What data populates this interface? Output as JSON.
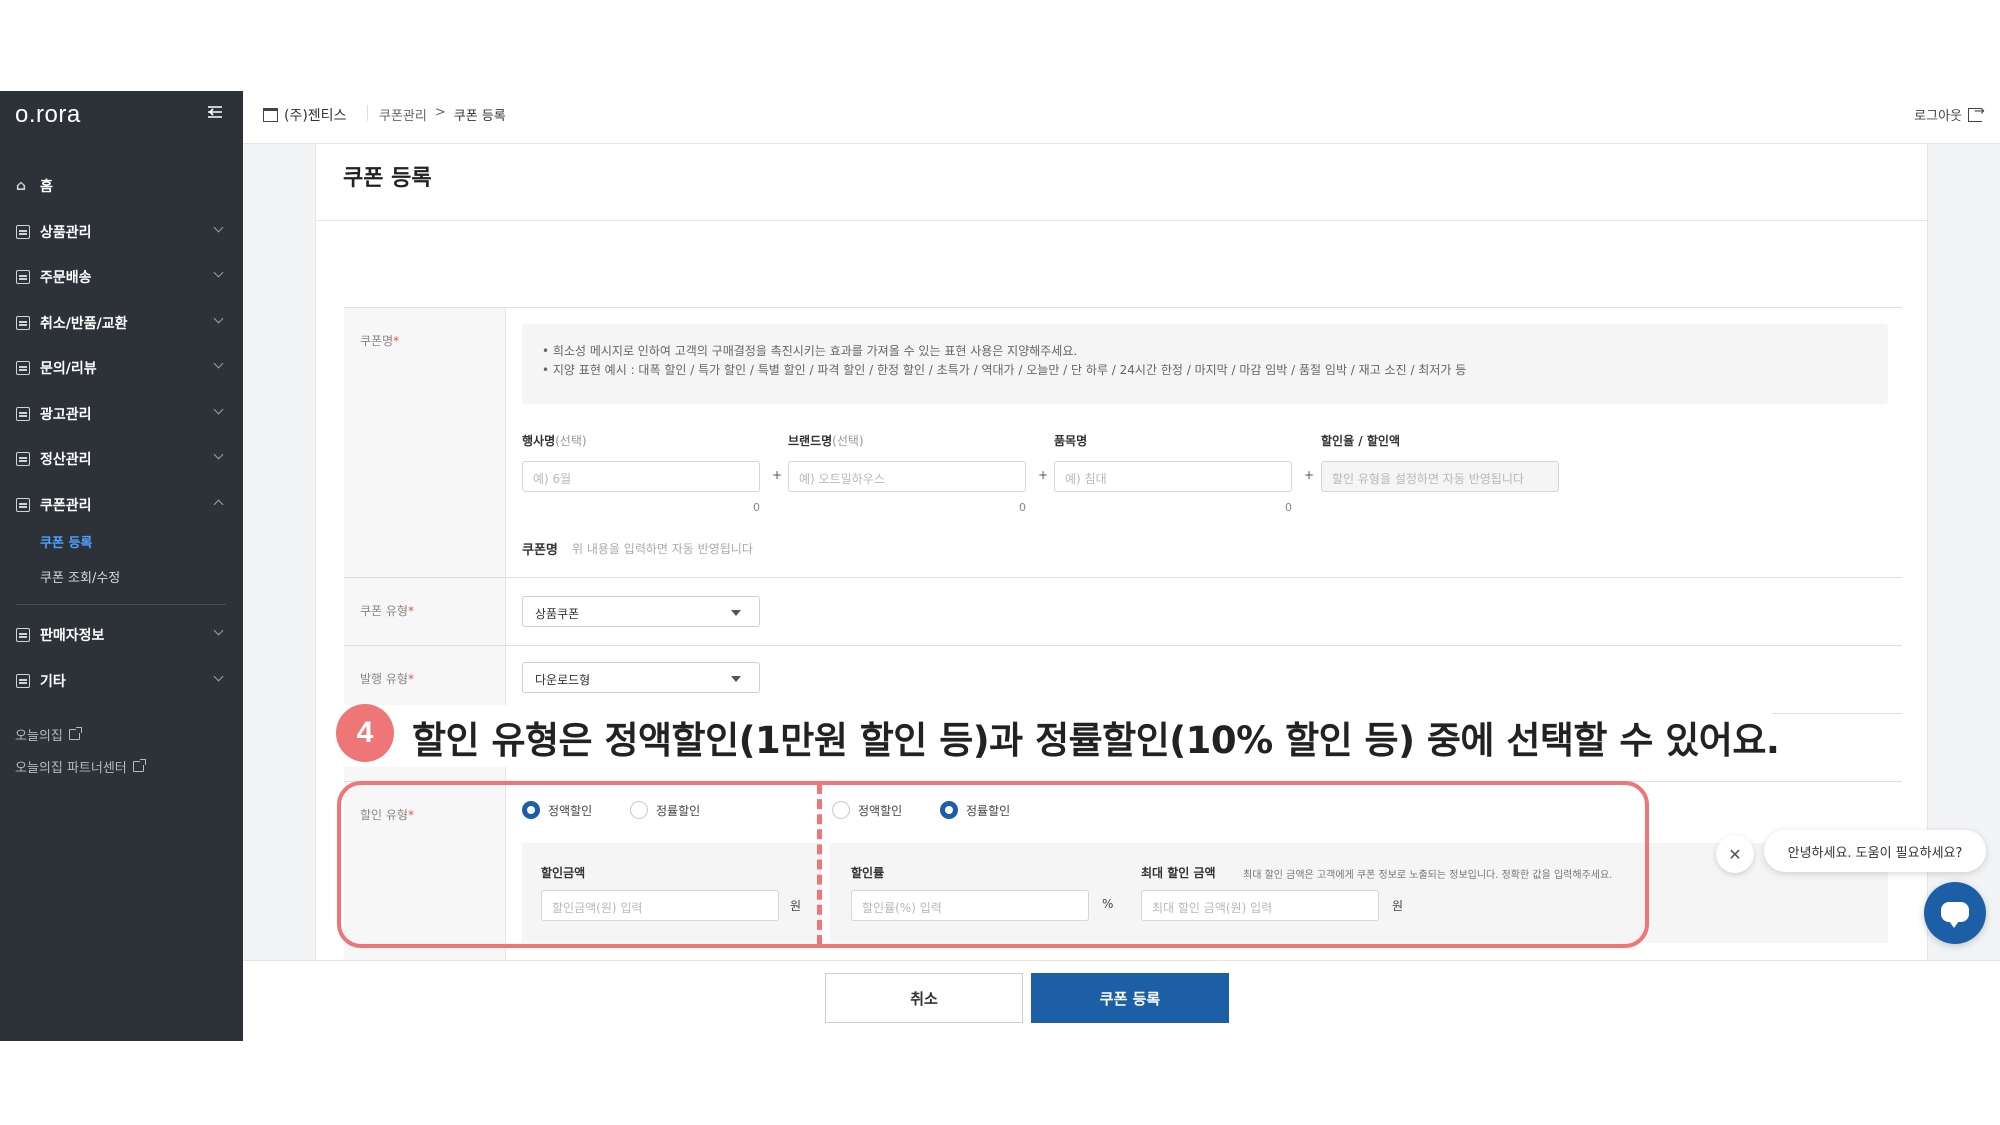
{
  "sidebar": {
    "logo": "o.rora",
    "home": "홈",
    "items": [
      {
        "label": "상품관리"
      },
      {
        "label": "주문배송"
      },
      {
        "label": "취소/반품/교환"
      },
      {
        "label": "문의/리뷰"
      },
      {
        "label": "광고관리"
      },
      {
        "label": "정산관리"
      },
      {
        "label": "쿠폰관리"
      }
    ],
    "coupon_sub": [
      "쿠폰 등록",
      "쿠폰 조회/수정"
    ],
    "items2": [
      {
        "label": "판매자정보"
      },
      {
        "label": "기타"
      }
    ],
    "links": [
      "오늘의집",
      "오늘의집 파트너센터"
    ]
  },
  "topbar": {
    "store": "(주)젠티스",
    "breadcrumb": [
      "쿠폰관리",
      ">",
      "쿠폰 등록"
    ],
    "logout": "로그아웃"
  },
  "page": {
    "title": "쿠폰 등록"
  },
  "form": {
    "coupon_name_label": "쿠폰명",
    "req": "*",
    "notice": [
      "• 희소성 메시지로 인하여 고객의 구매결정을 촉진시키는 효과를 가져올 수 있는 표현 사용은 지양해주세요.",
      "• 지양 표현 예시 : 대폭 할인 / 특가 할인 / 특별 할인 / 파격 할인 / 한정 할인 / 초특가 / 역대가 / 오늘만 / 단 하루 / 24시간 한정 / 마지막 / 마감 임박 / 품절 임박 / 재고 소진 / 최저가 등"
    ],
    "event_label": "행사명",
    "brand_label": "브랜드명",
    "optional": "(선택)",
    "item_label": "품목명",
    "discount_label": "할인율 / 할인액",
    "event_placeholder": "예) 6월",
    "brand_placeholder": "예) 오트밀하우스",
    "item_placeholder": "예) 침대",
    "discount_placeholder": "할인 유형을 설정하면 자동 반영됩니다",
    "plus": "+",
    "counts": [
      "0",
      "0",
      "0"
    ],
    "cname_label": "쿠폰명",
    "cname_hint": "위 내용을 입력하면 자동 반영됩니다",
    "coupon_type_label": "쿠폰 유형",
    "coupon_type_value": "상품쿠폰",
    "issue_type_label": "발행 유형",
    "issue_type_value": "다운로드형",
    "discount_type_label": "할인 유형",
    "radio_fixed": "정액할인",
    "radio_rate": "정률할인",
    "amount_label": "할인금액",
    "amount_placeholder": "할인금액(원) 입력",
    "won": "원",
    "rate_label": "할인률",
    "rate_placeholder": "할인률(%) 입력",
    "percent": "%",
    "max_label": "최대 할인 금액",
    "max_hint": "최대 할인 금액은 고객에게 쿠폰 정보로 노출되는 정보입니다. 정확한 값을 입력해주세요.",
    "max_placeholder": "최대 할인 금액(원) 입력"
  },
  "footer": {
    "cancel": "취소",
    "submit": "쿠폰 등록"
  },
  "chat": {
    "greeting": "안녕하세요. 도움이 필요하세요?",
    "close": "✕"
  },
  "tutorial": {
    "step": "4",
    "text": "할인 유형은 정액할인(1만원 할인 등)과 정률할인(10% 할인 등) 중에 선택할 수 있어요."
  },
  "colors": {
    "sidebar_bg": "#2d3238",
    "primary": "#1d5fa6",
    "accent_active": "#4ea1ff",
    "tutorial": "#ee7677"
  }
}
